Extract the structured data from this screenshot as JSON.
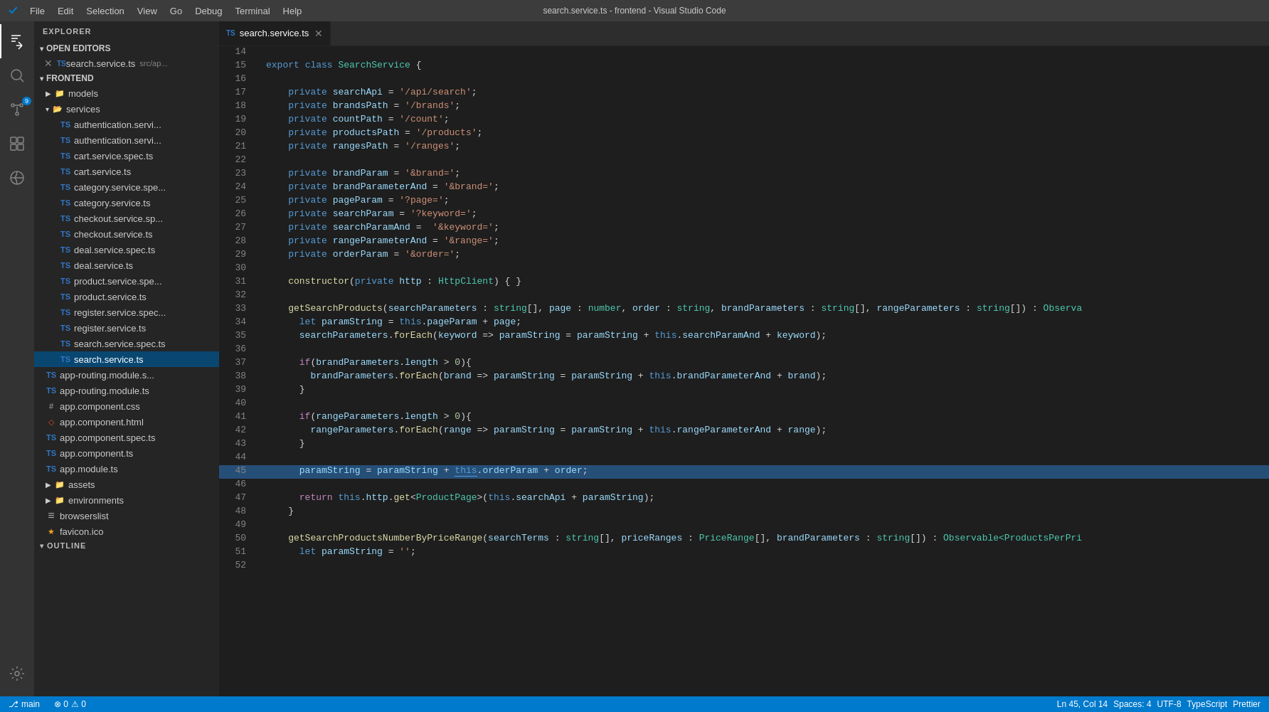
{
  "titleBar": {
    "title": "search.service.ts - frontend - Visual Studio Code",
    "menuItems": [
      "File",
      "Edit",
      "Selection",
      "View",
      "Go",
      "Debug",
      "Terminal",
      "Help"
    ]
  },
  "sidebar": {
    "header": "EXPLORER",
    "openEditors": {
      "label": "OPEN EDITORS",
      "items": [
        {
          "name": "search.service.ts",
          "path": "src/ap...",
          "type": "ts"
        }
      ]
    },
    "frontend": {
      "label": "FRONTEND",
      "items": [
        {
          "name": "models",
          "type": "folder",
          "indent": 16
        },
        {
          "name": "services",
          "type": "folder",
          "indent": 16,
          "expanded": true
        },
        {
          "name": "authentication.servi...",
          "type": "ts",
          "indent": 36
        },
        {
          "name": "authentication.servi...",
          "type": "ts",
          "indent": 36
        },
        {
          "name": "cart.service.spec.ts",
          "type": "ts",
          "indent": 36
        },
        {
          "name": "cart.service.ts",
          "type": "ts",
          "indent": 36
        },
        {
          "name": "category.service.spe...",
          "type": "ts",
          "indent": 36
        },
        {
          "name": "category.service.ts",
          "type": "ts",
          "indent": 36
        },
        {
          "name": "checkout.service.sp...",
          "type": "ts",
          "indent": 36
        },
        {
          "name": "checkout.service.ts",
          "type": "ts",
          "indent": 36
        },
        {
          "name": "deal.service.spec.ts",
          "type": "ts",
          "indent": 36
        },
        {
          "name": "deal.service.ts",
          "type": "ts",
          "indent": 36
        },
        {
          "name": "product.service.spe...",
          "type": "ts",
          "indent": 36
        },
        {
          "name": "product.service.ts",
          "type": "ts",
          "indent": 36
        },
        {
          "name": "register.service.spec...",
          "type": "ts",
          "indent": 36
        },
        {
          "name": "register.service.ts",
          "type": "ts",
          "indent": 36
        },
        {
          "name": "search.service.spec.ts",
          "type": "ts",
          "indent": 36
        },
        {
          "name": "search.service.ts",
          "type": "ts",
          "indent": 36,
          "active": true
        },
        {
          "name": "app-routing.module.s...",
          "type": "ts",
          "indent": 16
        },
        {
          "name": "app-routing.module.ts",
          "type": "ts",
          "indent": 16
        },
        {
          "name": "app.component.css",
          "type": "css",
          "indent": 16
        },
        {
          "name": "app.component.html",
          "type": "html",
          "indent": 16
        },
        {
          "name": "app.component.spec.ts",
          "type": "ts",
          "indent": 16
        },
        {
          "name": "app.component.ts",
          "type": "ts",
          "indent": 16
        },
        {
          "name": "app.module.ts",
          "type": "ts",
          "indent": 16
        },
        {
          "name": "assets",
          "type": "folder",
          "indent": 16
        },
        {
          "name": "environments",
          "type": "folder",
          "indent": 16
        },
        {
          "name": "browserslist",
          "type": "file",
          "indent": 16
        },
        {
          "name": "favicon.ico",
          "type": "ico",
          "indent": 16
        }
      ]
    },
    "outline": "OUTLINE"
  },
  "tab": {
    "filename": "search.service.ts",
    "type": "ts"
  },
  "code": {
    "lines": [
      {
        "num": 14,
        "content": ""
      },
      {
        "num": 15,
        "content": "export class SearchService {"
      },
      {
        "num": 16,
        "content": ""
      },
      {
        "num": 17,
        "content": "    private searchApi = '/api/search';"
      },
      {
        "num": 18,
        "content": "    private brandsPath = '/brands';"
      },
      {
        "num": 19,
        "content": "    private countPath = '/count';"
      },
      {
        "num": 20,
        "content": "    private productsPath = '/products';"
      },
      {
        "num": 21,
        "content": "    private rangesPath = '/ranges';"
      },
      {
        "num": 22,
        "content": ""
      },
      {
        "num": 23,
        "content": "    private brandParam = '&brand=';"
      },
      {
        "num": 24,
        "content": "    private brandParameterAnd = '&brand=';"
      },
      {
        "num": 25,
        "content": "    private pageParam = '?page=';"
      },
      {
        "num": 26,
        "content": "    private searchParam = '?keyword=';"
      },
      {
        "num": 27,
        "content": "    private searchParamAnd = '&keyword=';"
      },
      {
        "num": 28,
        "content": "    private rangeParameterAnd = '&range=';"
      },
      {
        "num": 29,
        "content": "    private orderParam = '&order=';"
      },
      {
        "num": 30,
        "content": ""
      },
      {
        "num": 31,
        "content": "    constructor(private http : HttpClient) { }"
      },
      {
        "num": 32,
        "content": ""
      },
      {
        "num": 33,
        "content": "    getSearchProducts(searchParameters : string[], page : number, order : string, brandParameters : string[], rangeParameters : string[]) : Observa"
      },
      {
        "num": 34,
        "content": "      let paramString = this.pageParam + page;"
      },
      {
        "num": 35,
        "content": "      searchParameters.forEach(keyword => paramString = paramString + this.searchParamAnd + keyword);"
      },
      {
        "num": 36,
        "content": ""
      },
      {
        "num": 37,
        "content": "      if(brandParameters.length > 0){"
      },
      {
        "num": 38,
        "content": "        brandParameters.forEach(brand => paramString = paramString + this.brandParameterAnd + brand);"
      },
      {
        "num": 39,
        "content": "      }"
      },
      {
        "num": 40,
        "content": ""
      },
      {
        "num": 41,
        "content": "      if(rangeParameters.length > 0){"
      },
      {
        "num": 42,
        "content": "        rangeParameters.forEach(range => paramString = paramString + this.rangeParameterAnd + range);"
      },
      {
        "num": 43,
        "content": "      }"
      },
      {
        "num": 44,
        "content": ""
      },
      {
        "num": 45,
        "content": "      paramString = paramString + this.orderParam + order;"
      },
      {
        "num": 46,
        "content": ""
      },
      {
        "num": 47,
        "content": "      return this.http.get<ProductPage>(this.searchApi + paramString);"
      },
      {
        "num": 48,
        "content": "    }"
      },
      {
        "num": 49,
        "content": ""
      },
      {
        "num": 50,
        "content": "    getSearchProductsNumberByPriceRange(searchTerms : string[], priceRanges : PriceRange[], brandParameters : string[]) : Observable<ProductsPerPri"
      },
      {
        "num": 51,
        "content": "      let paramString = '';"
      },
      {
        "num": 52,
        "content": ""
      }
    ]
  },
  "statusBar": {
    "items": [
      "⎇ main",
      "Ln 45, Col 14",
      "Spaces: 4",
      "UTF-8",
      "TypeScript",
      "Prettier"
    ]
  }
}
